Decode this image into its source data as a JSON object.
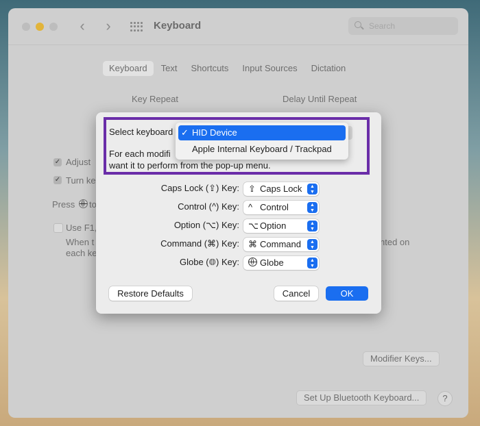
{
  "window": {
    "title": "Keyboard",
    "search_placeholder": "Search",
    "colors": {
      "accent": "#1a6ef0",
      "highlight_box": "#6a2da8",
      "minimize_light": "#e2b43a"
    }
  },
  "tabs": [
    {
      "label": "Keyboard",
      "active": true
    },
    {
      "label": "Text",
      "active": false
    },
    {
      "label": "Shortcuts",
      "active": false
    },
    {
      "label": "Input Sources",
      "active": false
    },
    {
      "label": "Dictation",
      "active": false
    }
  ],
  "pane": {
    "key_repeat_label": "Key Repeat",
    "delay_label": "Delay Until Repeat",
    "adjust_partial": "Adjust",
    "turn_partial": "Turn ke",
    "press_partial": "Press",
    "press_partial_suffix": "to",
    "use_f1_partial": "Use F1,",
    "when_partial": "When t",
    "each_partial": "each ke",
    "nted_partial": "nted on",
    "modifier_keys_button": "Modifier Keys...",
    "bluetooth_button": "Set Up Bluetooth Keyboard...",
    "help_label": "?"
  },
  "sheet": {
    "select_keyboard_label": "Select keyboard",
    "description_line1": "For each modifi",
    "description_line2": "want it to perform from the pop-up menu.",
    "keyboard_menu": {
      "options": [
        "HID Device",
        "Apple Internal Keyboard / Trackpad"
      ],
      "selected": "HID Device",
      "check_glyph": "✓"
    },
    "modifiers": [
      {
        "label": "Caps Lock (⇪) Key:",
        "value_symbol": "⇪",
        "value": "Caps Lock"
      },
      {
        "label": "Control (^) Key:",
        "value_symbol": "^",
        "value": "Control"
      },
      {
        "label": "Option (⌥) Key:",
        "value_symbol": "⌥",
        "value": "Option"
      },
      {
        "label": "Command (⌘) Key:",
        "value_symbol": "⌘",
        "value": "Command"
      },
      {
        "label": "Globe (🌐︎) Key:",
        "value_symbol": "globe-icon",
        "value": "Globe"
      }
    ],
    "restore_defaults": "Restore Defaults",
    "cancel": "Cancel",
    "ok": "OK"
  }
}
